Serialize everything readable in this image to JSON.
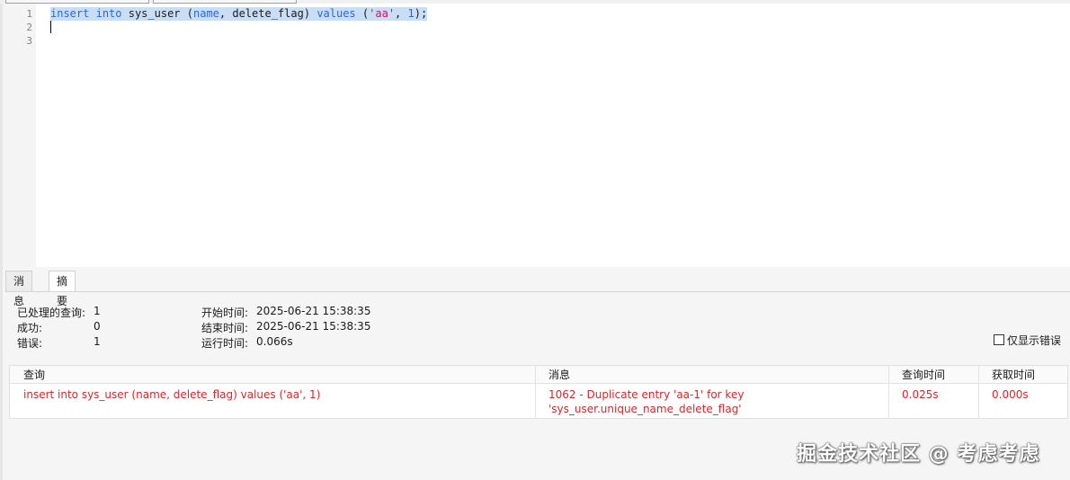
{
  "editor": {
    "line_numbers": [
      "1",
      "2",
      "3"
    ],
    "line1": {
      "kw_insert": "insert",
      "kw_into": "into",
      "table": "sys_user",
      "paren_open": "(",
      "col_name": "name",
      "sep1": ", ",
      "col_flag": "delete_flag",
      "paren_close": ")",
      "kw_values": "values",
      "vparen_open": "(",
      "str_val": "'aa'",
      "sep2": ", ",
      "num_val": "1",
      "end": ");"
    }
  },
  "result_tabs": [
    "消息",
    "摘要"
  ],
  "summary": {
    "processed_label": "已处理的查询:",
    "processed_value": "1",
    "success_label": "成功:",
    "success_value": "0",
    "error_label": "错误:",
    "error_value": "1",
    "start_label": "开始时间:",
    "start_value": "2025-06-21 15:38:35",
    "end_label": "结束时间:",
    "end_value": "2025-06-21 15:38:35",
    "run_label": "运行时间:",
    "run_value": "0.066s"
  },
  "errors_only_label": "仅显示错误",
  "grid": {
    "headers": [
      "查询",
      "消息",
      "查询时间",
      "获取时间"
    ],
    "row": {
      "query": "insert into sys_user (name, delete_flag) values ('aa', 1)",
      "message_line1": "1062 - Duplicate entry 'aa-1' for key",
      "message_line2": "'sys_user.unique_name_delete_flag'",
      "query_time": "0.025s",
      "fetch_time": "0.000s"
    }
  },
  "watermark": "掘金技术社区 @ 考虑考虑",
  "colors": {
    "selection": "#c9def5",
    "keyword": "#2a66d8",
    "string": "#c2185b",
    "error_text": "#d8262b"
  }
}
